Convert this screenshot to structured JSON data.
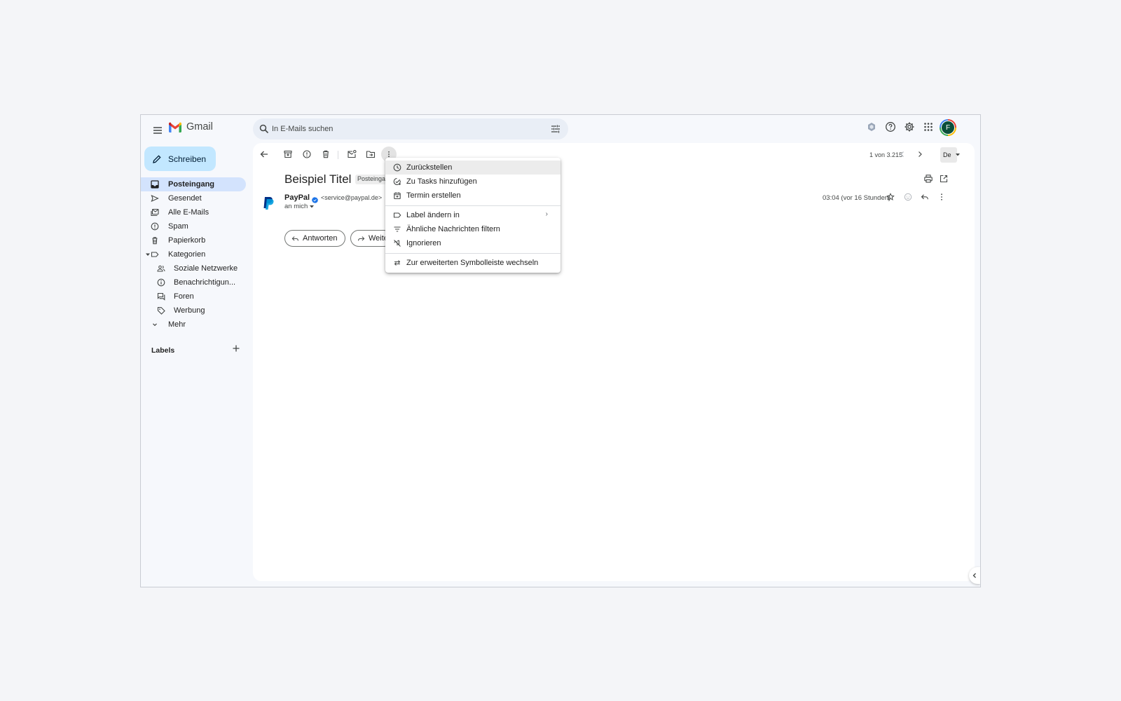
{
  "app": {
    "name": "Gmail"
  },
  "search": {
    "placeholder": "In E-Mails suchen"
  },
  "account": {
    "initial": "F"
  },
  "sidebar": {
    "compose_label": "Schreiben",
    "items": [
      {
        "label": "Posteingang",
        "icon": "inbox-icon",
        "active": true
      },
      {
        "label": "Gesendet",
        "icon": "send-icon"
      },
      {
        "label": "Alle E-Mails",
        "icon": "all-mail-icon"
      },
      {
        "label": "Spam",
        "icon": "spam-icon"
      },
      {
        "label": "Papierkorb",
        "icon": "trash-icon"
      },
      {
        "label": "Kategorien",
        "icon": "label-icon"
      },
      {
        "label": "Soziale Netzwerke",
        "icon": "people-icon"
      },
      {
        "label": "Benachrichtigun...",
        "icon": "info-icon"
      },
      {
        "label": "Foren",
        "icon": "forum-icon"
      },
      {
        "label": "Werbung",
        "icon": "tag-icon"
      },
      {
        "label": "Mehr",
        "icon": "chevron-down-icon"
      }
    ],
    "labels_header": "Labels"
  },
  "toolbar": {
    "pager_text": "1 von 3.215",
    "lang": "De"
  },
  "message": {
    "subject": "Beispiel Titel",
    "label_chip": "Posteingang",
    "sender_name": "PayPal",
    "sender_email": "<service@paypal.de>",
    "to": "an mich",
    "time": "03:04 (vor 16 Stunden)",
    "reply_label": "Antworten",
    "forward_label": "Weiterleiten"
  },
  "menu": {
    "items": [
      {
        "label": "Zurückstellen",
        "icon": "clock-icon",
        "highlighted": true
      },
      {
        "label": "Zu Tasks hinzufügen",
        "icon": "add-task-icon"
      },
      {
        "label": "Termin erstellen",
        "icon": "calendar-icon"
      },
      {
        "label": "Label ändern in",
        "icon": "label-icon",
        "submenu": true
      },
      {
        "label": "Ähnliche Nachrichten filtern",
        "icon": "filter-icon"
      },
      {
        "label": "Ignorieren",
        "icon": "mute-icon"
      },
      {
        "label": "Zur erweiterten Symbolleiste wechseln",
        "icon": "swap-icon"
      }
    ],
    "submenu_glyph": "›"
  },
  "colors": {
    "accent": "#c2e7ff",
    "active_nav": "#d3e3fd",
    "paypal_dark": "#003087",
    "paypal_light": "#009cde",
    "verified": "#1a73e8",
    "avatar": "#0b4f3b"
  }
}
